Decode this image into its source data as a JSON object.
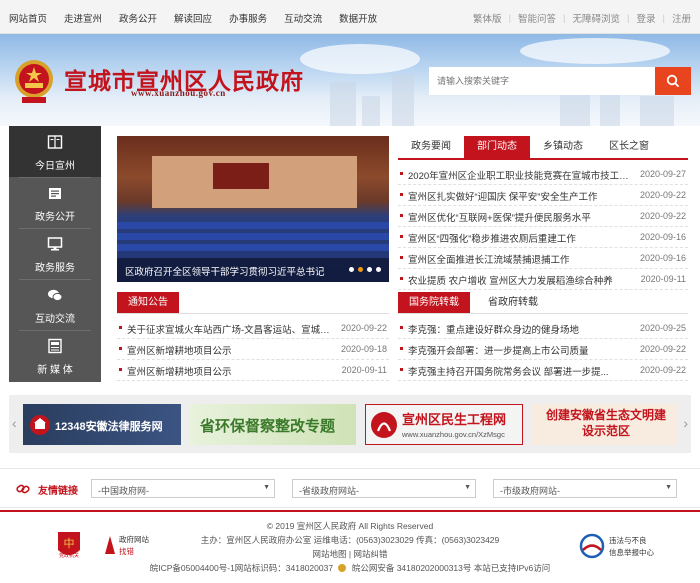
{
  "topnav": {
    "items": [
      "网站首页",
      "走进宣州",
      "政务公开",
      "解读回应",
      "办事服务",
      "互动交流",
      "数据开放"
    ],
    "right": [
      "繁体版",
      "智能问答",
      "无障碍浏览",
      "登录",
      "注册"
    ]
  },
  "header": {
    "title": "宣城市宣州区人民政府",
    "domain": "www.xuanzhou.gov.cn",
    "search_placeholder": "请输入搜索关键字"
  },
  "sidemenu": {
    "items": [
      "今日宣州",
      "政务公开",
      "政务服务",
      "互动交流",
      "新 媒 体"
    ]
  },
  "carousel": {
    "caption": "区政府召开全区领导干部学习贯彻习近平总书记",
    "active_dot": 1
  },
  "tabs": {
    "items": [
      "政务要闻",
      "部门动态",
      "乡镇动态",
      "区长之窗"
    ],
    "active": 1
  },
  "dept_news": [
    {
      "title": "2020年宣州区企业职工职业技能竞赛在宣城市技工学...",
      "date": "2020-09-27"
    },
    {
      "title": "宣州区扎实做好“迎国庆 保平安”安全生产工作",
      "date": "2020-09-22"
    },
    {
      "title": "宣州区优化“互联网+医保”提升便民服务水平",
      "date": "2020-09-22"
    },
    {
      "title": "宣州区“四强化”稳步推进农厕后重建工作",
      "date": "2020-09-16"
    },
    {
      "title": "宣州区全面推进长江流域禁捕退捕工作",
      "date": "2020-09-16"
    },
    {
      "title": "农业提质 农户增收 宣州区大力发展稻渔综合种养",
      "date": "2020-09-11"
    }
  ],
  "notice": {
    "title": "通知公告",
    "items": [
      {
        "title": "关于征求宣城火车站西广场-文昌客运站、宣城火车...",
        "date": "2020-09-22"
      },
      {
        "title": "宣州区新增耕地项目公示",
        "date": "2020-09-18"
      },
      {
        "title": "宣州区新增耕地项目公示",
        "date": "2020-09-11"
      }
    ]
  },
  "state_council": {
    "tabs": [
      "国务院转载",
      "省政府转载"
    ],
    "items": [
      {
        "title": "李克强：重点建设好群众身边的健身场地",
        "date": "2020-09-25"
      },
      {
        "title": "李克强开会部署：进一步提高上市公司质量",
        "date": "2020-09-22"
      },
      {
        "title": "李克强主持召开国务院常务会议 部署进一步提...",
        "date": "2020-09-22"
      }
    ]
  },
  "ads": [
    {
      "label": "12348安徽法律服务网"
    },
    {
      "label": "省环保督察整改专题"
    },
    {
      "label": "宣州区民生工程网",
      "sub": "www.xuanzhou.gov.cn/XzMsgc"
    },
    {
      "label": "创建安徽省生态文明建设示范区"
    }
  ],
  "friend_links": {
    "label": "友情链接",
    "selects": [
      "-中国政府网-",
      "-省级政府网站-",
      "-市级政府网站-"
    ]
  },
  "footer": {
    "copyright": "© 2019 宣州区人民政府 All Rights Reserved",
    "host": "主办：宣州区人民政府办公室 运维电话：(0563)3023029 传真：(0563)3023429",
    "links": "网站地图 | 网站纠错",
    "icp": "皖ICP备05004400号-1网站标识码：3418020037",
    "police": "皖公网安备 34180202000313号 本站已支持IPv6访问",
    "badge1": "党政机关",
    "badge2_a": "政府网站",
    "badge2_b": "找错",
    "badge3_a": "违法与不良",
    "badge3_b": "信息举报中心"
  },
  "colors": {
    "brand_red": "#c3131c",
    "search_orange": "#e8441d",
    "side_gray": "#565656"
  }
}
